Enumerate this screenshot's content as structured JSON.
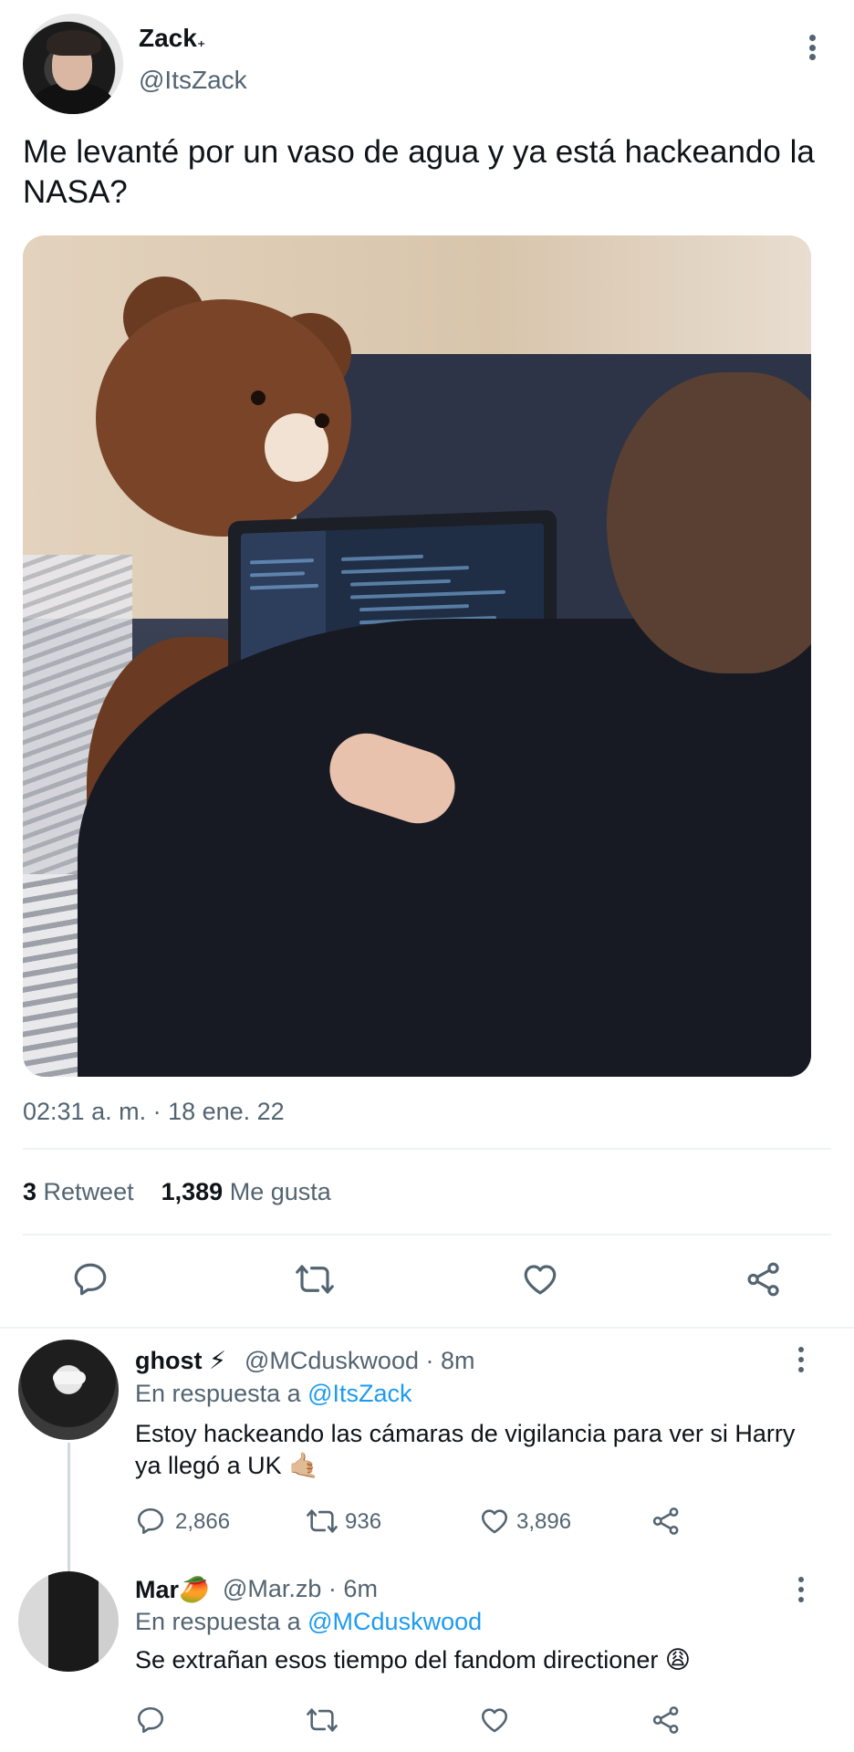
{
  "main_tweet": {
    "author_name": "Zack",
    "author_badge": "₊",
    "author_handle": "@ItsZack",
    "text": "Me levanté por un vaso de agua y ya está hackeando la NASA?",
    "media_icon": "photo-teddy-bear-laptop",
    "timestamp": "02:31 a. m. · 18 ene. 22",
    "retweets_count": "3",
    "retweets_label": "Retweet",
    "likes_count": "1,389",
    "likes_label": "Me gusta"
  },
  "replies": [
    {
      "name": "ghost",
      "name_suffix": "⚡︎",
      "handle_time": "@MCduskwood · 8m",
      "replying_label": "En respuesta a",
      "replying_to": "@ItsZack",
      "text": "Estoy hackeando las cámaras de vigilancia para ver si Harry ya llegó a UK 🤙🏼",
      "replies_count": "2,866",
      "retweets_count": "936",
      "likes_count": "3,896"
    },
    {
      "name": "Mar",
      "name_suffix": "🥭",
      "handle_time": "@Mar.zb · 6m",
      "replying_label": "En respuesta a",
      "replying_to": "@MCduskwood",
      "text": "Se extrañan esos tiempo del fandom directioner 😩",
      "replies_count": "",
      "retweets_count": "",
      "likes_count": ""
    }
  ],
  "colors": {
    "text": "#0f1419",
    "secondary": "#536471",
    "link": "#1d9bf0",
    "divider": "#eff3f4"
  }
}
